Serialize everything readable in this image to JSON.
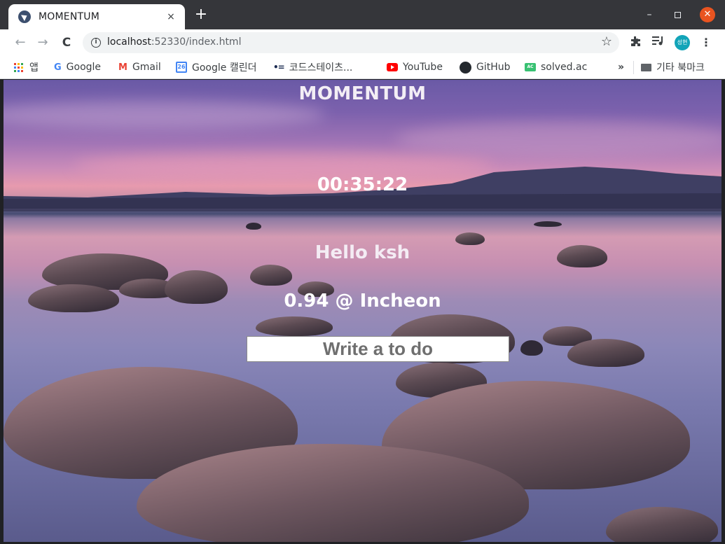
{
  "browser": {
    "tab_title": "MOMENTUM",
    "tab_close": "×",
    "new_tab": "+",
    "window_controls": {
      "minimize": "–",
      "close": "✕"
    },
    "nav": {
      "back": "←",
      "forward": "→",
      "reload": "C"
    },
    "url_host": "localhost",
    "url_rest": ":52330/index.html",
    "icons": {
      "site_info": "i",
      "bookmark_star": "☆",
      "extensions": "puzzle-icon",
      "media": "media-queue-icon",
      "menu": "⋮"
    },
    "profile_avatar": "성현"
  },
  "bookmarks": [
    {
      "label": "앱",
      "icon": "apps-grid-icon"
    },
    {
      "label": "Google",
      "icon": "google-icon",
      "glyph": "G"
    },
    {
      "label": "Gmail",
      "icon": "gmail-icon",
      "glyph": "M"
    },
    {
      "label": "Google 캘린더",
      "icon": "calendar-icon",
      "glyph": "26"
    },
    {
      "label": "코드스테이츠...",
      "icon": "codestates-icon",
      "glyph": "•="
    },
    {
      "label": "YouTube",
      "icon": "youtube-icon"
    },
    {
      "label": "GitHub",
      "icon": "github-icon"
    },
    {
      "label": "solved.ac",
      "icon": "solvedac-icon",
      "glyph": "AC"
    },
    {
      "label": "기타 북마크",
      "icon": "folder-icon"
    }
  ],
  "bookmarks_more": "»",
  "page": {
    "title": "MOMENTUM",
    "clock": "00:35:22",
    "greeting": "Hello ksh",
    "weather": "0.94 @ Incheon",
    "todo_placeholder": "Write a to do"
  },
  "colors": {
    "titlebar": "#35363a",
    "close_button": "#e95420",
    "avatar": "#12a4b8"
  }
}
